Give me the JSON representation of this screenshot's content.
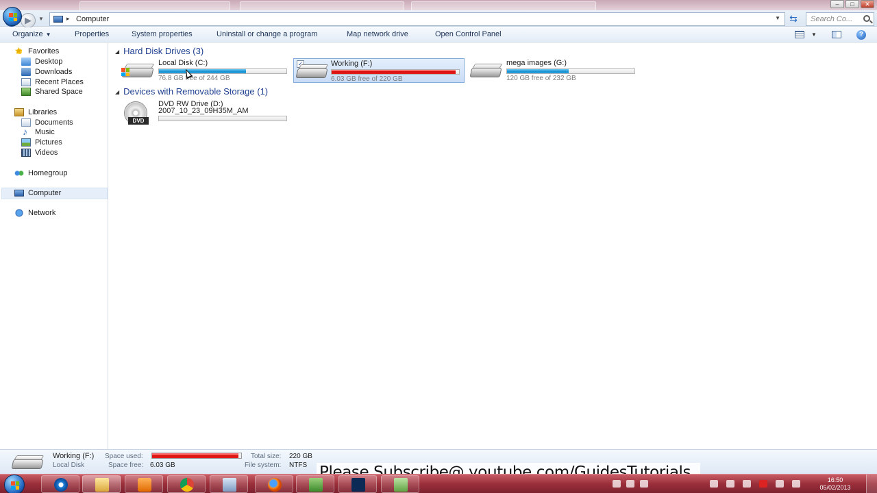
{
  "window": {
    "address_location": "Computer",
    "search_placeholder": "Search Co...",
    "min_glyph": "–",
    "max_glyph": "□",
    "close_glyph": "✕"
  },
  "toolbar": {
    "organize": "Organize",
    "properties": "Properties",
    "system_properties": "System properties",
    "uninstall": "Uninstall or change a program",
    "map_drive": "Map network drive",
    "control_panel": "Open Control Panel"
  },
  "sidebar": {
    "favorites": "Favorites",
    "desktop": "Desktop",
    "downloads": "Downloads",
    "recent_places": "Recent Places",
    "shared_space": "Shared Space",
    "libraries": "Libraries",
    "documents": "Documents",
    "music": "Music",
    "pictures": "Pictures",
    "videos": "Videos",
    "homegroup": "Homegroup",
    "computer": "Computer",
    "network": "Network"
  },
  "content": {
    "hdd_header": "Hard Disk Drives (3)",
    "removable_header": "Devices with Removable Storage (1)",
    "drives": [
      {
        "name": "Local Disk (C:)",
        "free_text": "76.8 GB free of 244 GB",
        "used_fraction": 0.685,
        "bar_color": "#1a8fd0"
      },
      {
        "name": "Working (F:)",
        "free_text": "6.03 GB free of 220 GB",
        "used_fraction": 0.973,
        "bar_color": "#d40c0c"
      },
      {
        "name": "mega images (G:)",
        "free_text": "120 GB free of 232 GB",
        "used_fraction": 0.483,
        "bar_color": "#1a8fd0"
      }
    ],
    "dvd": {
      "name": "DVD RW Drive (D:)",
      "volume": "2007_10_23_09H35M_AM",
      "badge": "DVD"
    }
  },
  "details": {
    "name": "Working (F:)",
    "type": "Local Disk",
    "space_used_label": "Space used:",
    "space_free_label": "Space free:",
    "space_free_value": "6.03 GB",
    "total_size_label": "Total size:",
    "total_size_value": "220 GB",
    "file_system_label": "File system:",
    "file_system_value": "NTFS",
    "used_fraction": 0.973
  },
  "banner": "Please Subscribe@ youtube.com/GuidesTutorials",
  "taskbar": {
    "time": "16:50",
    "date": "05/02/2013"
  }
}
